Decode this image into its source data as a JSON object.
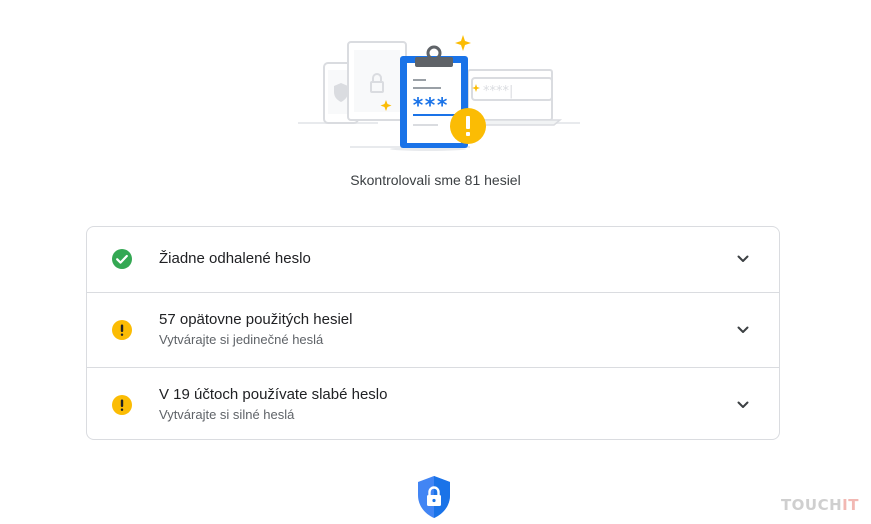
{
  "summary": {
    "text": "Skontrolovali sme 81 hesiel"
  },
  "items": [
    {
      "status": "ok",
      "status_icon": "check-circle-icon",
      "title": "Žiadne odhalené heslo",
      "subtitle": ""
    },
    {
      "status": "warning",
      "status_icon": "warning-circle-icon",
      "title": "57 opätovne použitých hesiel",
      "subtitle": "Vytvárajte si jedinečné heslá"
    },
    {
      "status": "warning",
      "status_icon": "warning-circle-icon",
      "title": "V 19 účtoch používate slabé heslo",
      "subtitle": "Vytvárajte si silné heslá"
    }
  ],
  "hero": {
    "masked_stars": "***",
    "masked_field": "****|"
  },
  "watermark": {
    "part1": "TOUCH",
    "part2": "IT"
  },
  "colors": {
    "ok": "#34a853",
    "warning": "#fbbc04",
    "brand_blue": "#1a73e8",
    "divider": "#dadce0",
    "chevron": "#3c4043"
  }
}
